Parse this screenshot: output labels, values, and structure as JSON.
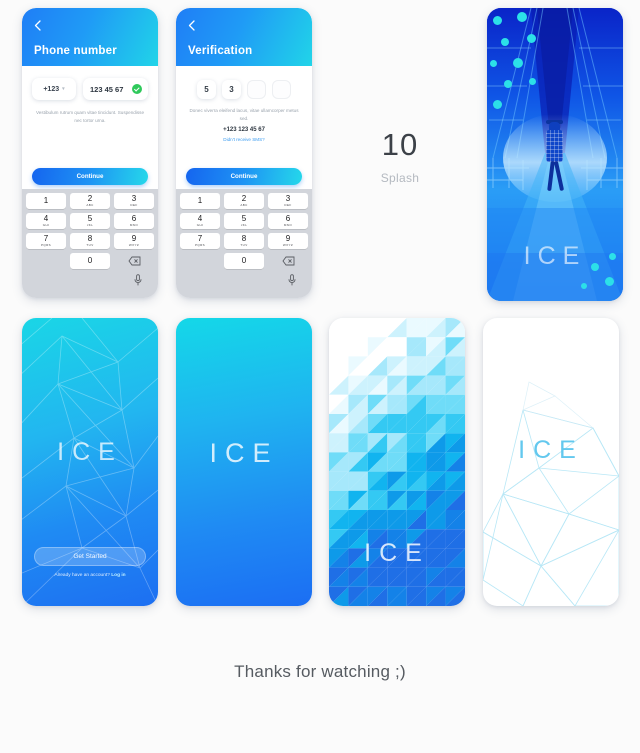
{
  "background_color": "#fbfbfb",
  "accent": {
    "blue": "#1e7ef4",
    "cyan": "#21d4e8",
    "green": "#2fc95b",
    "link": "#3a9bf0"
  },
  "screen_phone": {
    "back_icon": "chevron-left-icon",
    "title": "Phone number",
    "country_code": "+123",
    "country_chevron": "chevron-down-icon",
    "phone_value": "123 45 67",
    "valid_icon": "check-circle-icon",
    "hint": "Vestibulum rutrum quam vitae tincidunt. Suspendisse nec tortor urna.",
    "continue_label": "Continue"
  },
  "screen_verify": {
    "back_icon": "chevron-left-icon",
    "title": "Verification",
    "code_digits": [
      "5",
      "3",
      "",
      ""
    ],
    "hint": "Donec viverra eleifend lacus, vitae ullamcorper metus sed.",
    "phone": "+123 123 45 67",
    "resend_link": "Didn't receive SMS?",
    "continue_label": "Continue"
  },
  "keypad": {
    "keys": [
      {
        "digit": "1",
        "letters": ""
      },
      {
        "digit": "2",
        "letters": "ABC"
      },
      {
        "digit": "3",
        "letters": "DEF"
      },
      {
        "digit": "4",
        "letters": "GHI"
      },
      {
        "digit": "5",
        "letters": "JKL"
      },
      {
        "digit": "6",
        "letters": "MNO"
      },
      {
        "digit": "7",
        "letters": "PQRS"
      },
      {
        "digit": "8",
        "letters": "TUV"
      },
      {
        "digit": "9",
        "letters": "WXYZ"
      }
    ],
    "zero": {
      "digit": "0",
      "letters": ""
    },
    "backspace_icon": "backspace-icon",
    "mic_icon": "microphone-icon"
  },
  "splash": {
    "number": "10",
    "label": "Splash"
  },
  "photo_card": {
    "wordmark": "ICE",
    "subject": "person-on-bridge-photo"
  },
  "cards": [
    {
      "id": "b1",
      "wordmark": "ICE",
      "style": "gradient-with-polygon-lines"
    },
    {
      "id": "b2",
      "wordmark": "ICE",
      "style": "plain-gradient"
    },
    {
      "id": "b3",
      "wordmark": "ICE",
      "style": "triangle-mosaic"
    },
    {
      "id": "b4",
      "wordmark": "ICE",
      "style": "white-wireframe"
    }
  ],
  "onboarding": {
    "get_started_label": "Get Started",
    "account_prompt": "Already have an account?",
    "login_label": "Log in"
  },
  "footer": {
    "text": "Thanks for watching ;)"
  }
}
